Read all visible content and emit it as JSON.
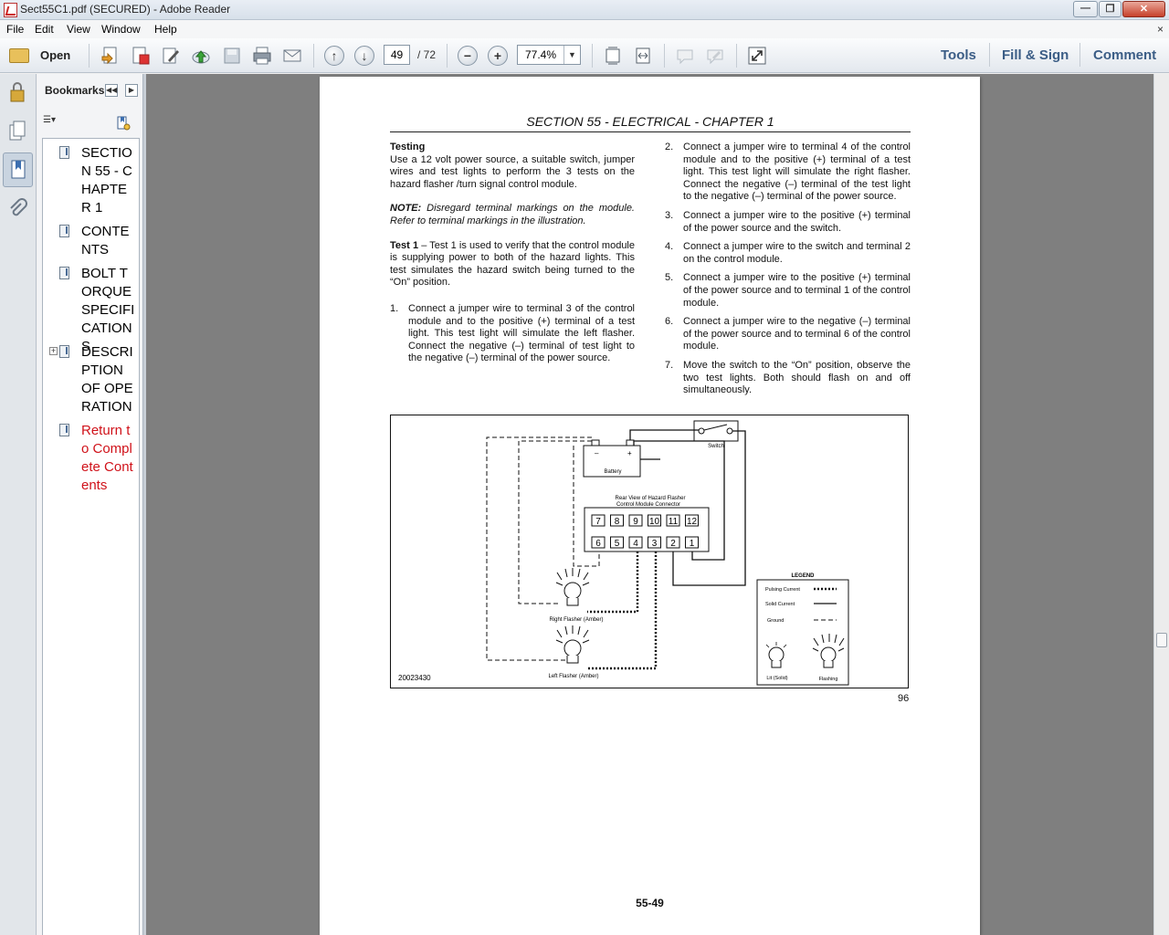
{
  "window": {
    "title": "Sect55C1.pdf (SECURED) - Adobe Reader"
  },
  "menu": {
    "file": "File",
    "edit": "Edit",
    "view": "View",
    "window": "Window",
    "help": "Help",
    "close_glyph": "×"
  },
  "toolbar": {
    "open_label": "Open",
    "page_current": "49",
    "page_total": "/ 72",
    "zoom": "77.4%",
    "tools": "Tools",
    "fill_sign": "Fill & Sign",
    "comment": "Comment"
  },
  "bookmarks": {
    "header": "Bookmarks",
    "items": [
      {
        "label": "SECTION 55 - CHAPTER 1"
      },
      {
        "label": "CONTENTS"
      },
      {
        "label": "BOLT TORQUE SPECIFICATIONS"
      },
      {
        "label": "DESCRIPTION OF OPERATION"
      },
      {
        "label": "Return to Complete Contents"
      }
    ]
  },
  "document": {
    "section_title": "SECTION 55 - ELECTRICAL - CHAPTER 1",
    "testing_heading": "Testing",
    "testing_body": "Use a 12 volt power source, a suitable switch, jumper wires and test lights to perform the 3 tests on the hazard flasher /turn signal control module.",
    "note_label": "NOTE:",
    "note_body": " Disregard terminal markings on the module. Refer to terminal markings in the illustration.",
    "test1_label": "Test 1",
    "test1_body": " – Test 1 is used to verify that the control module is supplying power to both of the hazard lights. This test simulates the hazard switch being turned to the “On” position.",
    "steps_left": [
      {
        "n": "1.",
        "text": "Connect a jumper wire to terminal 3 of the control module and to the positive (+) terminal of a test light. This test light will simulate the left flasher. Connect the negative (–) terminal of test light to the negative (–) terminal of the power source."
      }
    ],
    "steps_right": [
      {
        "n": "2.",
        "text": "Connect a jumper wire to terminal 4 of the control module and to the positive (+) terminal of a test light. This test light will simulate the right flasher. Connect the negative (–) terminal of the test light to the negative (–) terminal of the power source."
      },
      {
        "n": "3.",
        "text": "Connect a jumper wire to the positive (+) terminal of the power source and the switch."
      },
      {
        "n": "4.",
        "text": "Connect a jumper wire to the switch and terminal 2 on the control module."
      },
      {
        "n": "5.",
        "text": "Connect a jumper wire to the positive (+) terminal of the power source and to terminal 1 of the control module."
      },
      {
        "n": "6.",
        "text": "Connect a jumper wire to the negative (–) terminal of the power source and to terminal 6 of the control module."
      },
      {
        "n": "7.",
        "text": "Move the switch to the “On” position, observe the two test lights. Both should flash on and off simultaneously."
      }
    ],
    "figure": {
      "switch_label": "Switch",
      "battery_label": "Battery",
      "battery_neg": "–",
      "battery_pos": "+",
      "connector_title_1": "Rear View of Hazard Flasher",
      "connector_title_2": "Control Module Connector",
      "top_terminals": [
        "7",
        "8",
        "9",
        "10",
        "11",
        "12"
      ],
      "bottom_terminals": [
        "6",
        "5",
        "4",
        "3",
        "2",
        "1"
      ],
      "right_flasher": "Right Flasher (Amber)",
      "left_flasher": "Left Flasher (Amber)",
      "figure_id": "20023430",
      "legend_title": "LEGEND",
      "legend_pulsing": "Pulsing Current",
      "legend_solid": "Solid Current",
      "legend_ground": "Ground",
      "legend_lit": "Lit (Solid)",
      "legend_flashing": "Flashing"
    },
    "page_number_right": "96",
    "footer": "55-49"
  }
}
